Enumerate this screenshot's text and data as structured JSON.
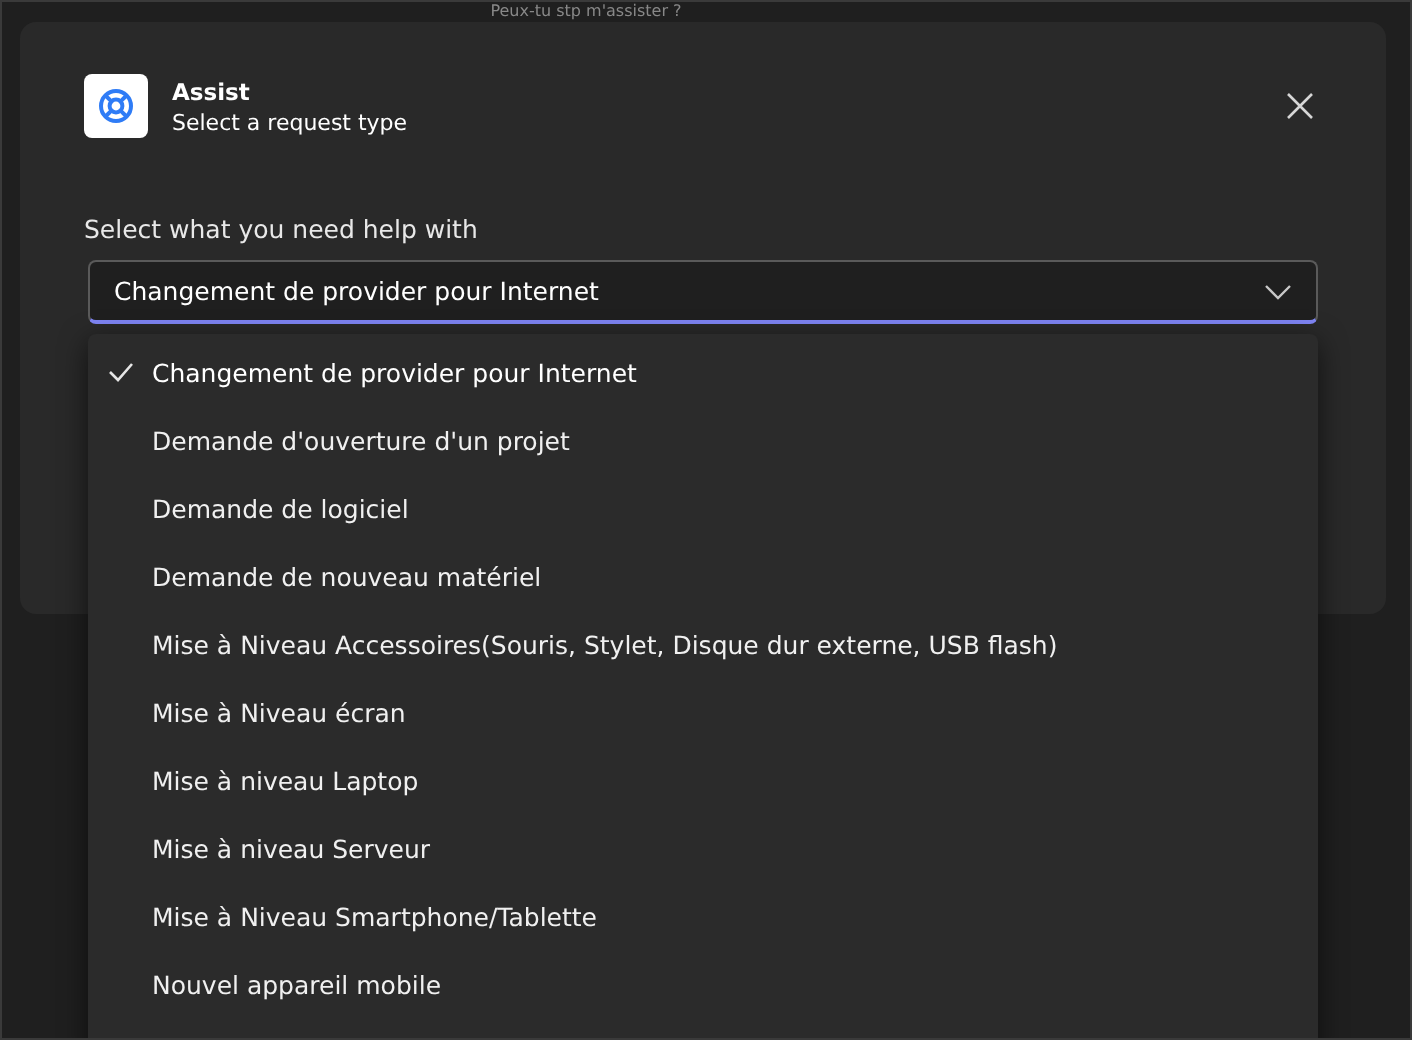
{
  "background": {
    "message": "Peux-tu stp m'assister ?"
  },
  "dialog": {
    "title": "Assist",
    "subtitle": "Select a request type",
    "field_label": "Select what you need help with",
    "dropdown": {
      "value": "Changement de provider pour Internet",
      "expanded": true
    },
    "options": [
      {
        "label": "Changement de provider pour Internet",
        "selected": true
      },
      {
        "label": "Demande d'ouverture d'un projet",
        "selected": false
      },
      {
        "label": "Demande de logiciel",
        "selected": false
      },
      {
        "label": "Demande de nouveau matériel",
        "selected": false
      },
      {
        "label": "Mise à Niveau Accessoires(Souris, Stylet, Disque dur externe, USB flash)",
        "selected": false
      },
      {
        "label": "Mise à Niveau écran",
        "selected": false
      },
      {
        "label": "Mise à niveau Laptop",
        "selected": false
      },
      {
        "label": "Mise à niveau Serveur",
        "selected": false
      },
      {
        "label": "Mise à Niveau Smartphone/Tablette",
        "selected": false
      },
      {
        "label": "Nouvel appareil mobile",
        "selected": false
      }
    ]
  }
}
